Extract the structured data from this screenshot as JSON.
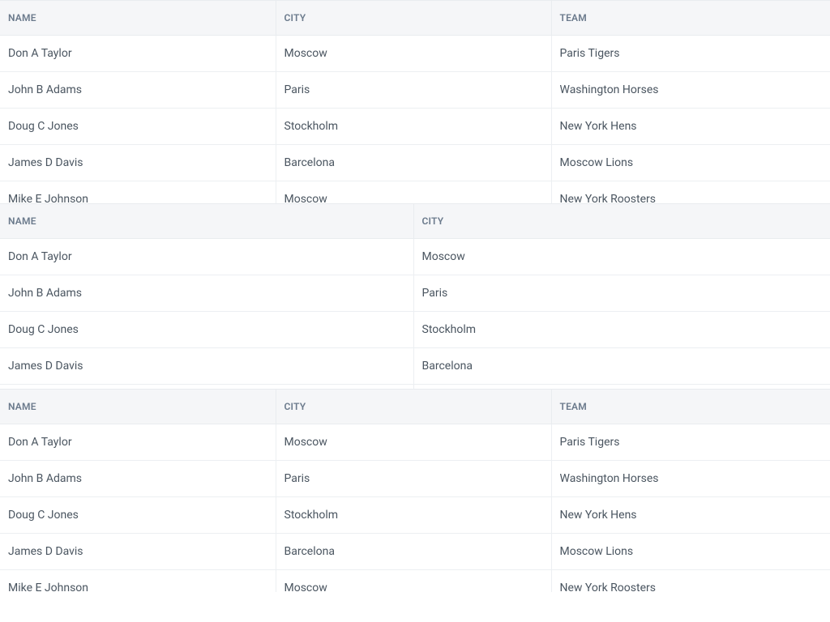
{
  "headers": {
    "name": "NAME",
    "city": "CITY",
    "team": "TEAM"
  },
  "rows": [
    {
      "name": "Don A Taylor",
      "city": "Moscow",
      "team": "Paris Tigers"
    },
    {
      "name": "John B Adams",
      "city": "Paris",
      "team": "Washington Horses"
    },
    {
      "name": "Doug C Jones",
      "city": "Stockholm",
      "team": "New York Hens"
    },
    {
      "name": "James D Davis",
      "city": "Barcelona",
      "team": "Moscow Lions"
    },
    {
      "name": "Mike E Johnson",
      "city": "Moscow",
      "team": "New York Roosters"
    }
  ],
  "tables": [
    {
      "id": "t1",
      "columns": [
        "name",
        "city",
        "team"
      ],
      "cls": "three-col"
    },
    {
      "id": "t2",
      "columns": [
        "name",
        "city"
      ],
      "cls": "two-col"
    },
    {
      "id": "t3",
      "columns": [
        "name",
        "city",
        "team"
      ],
      "cls": "three-col"
    }
  ]
}
